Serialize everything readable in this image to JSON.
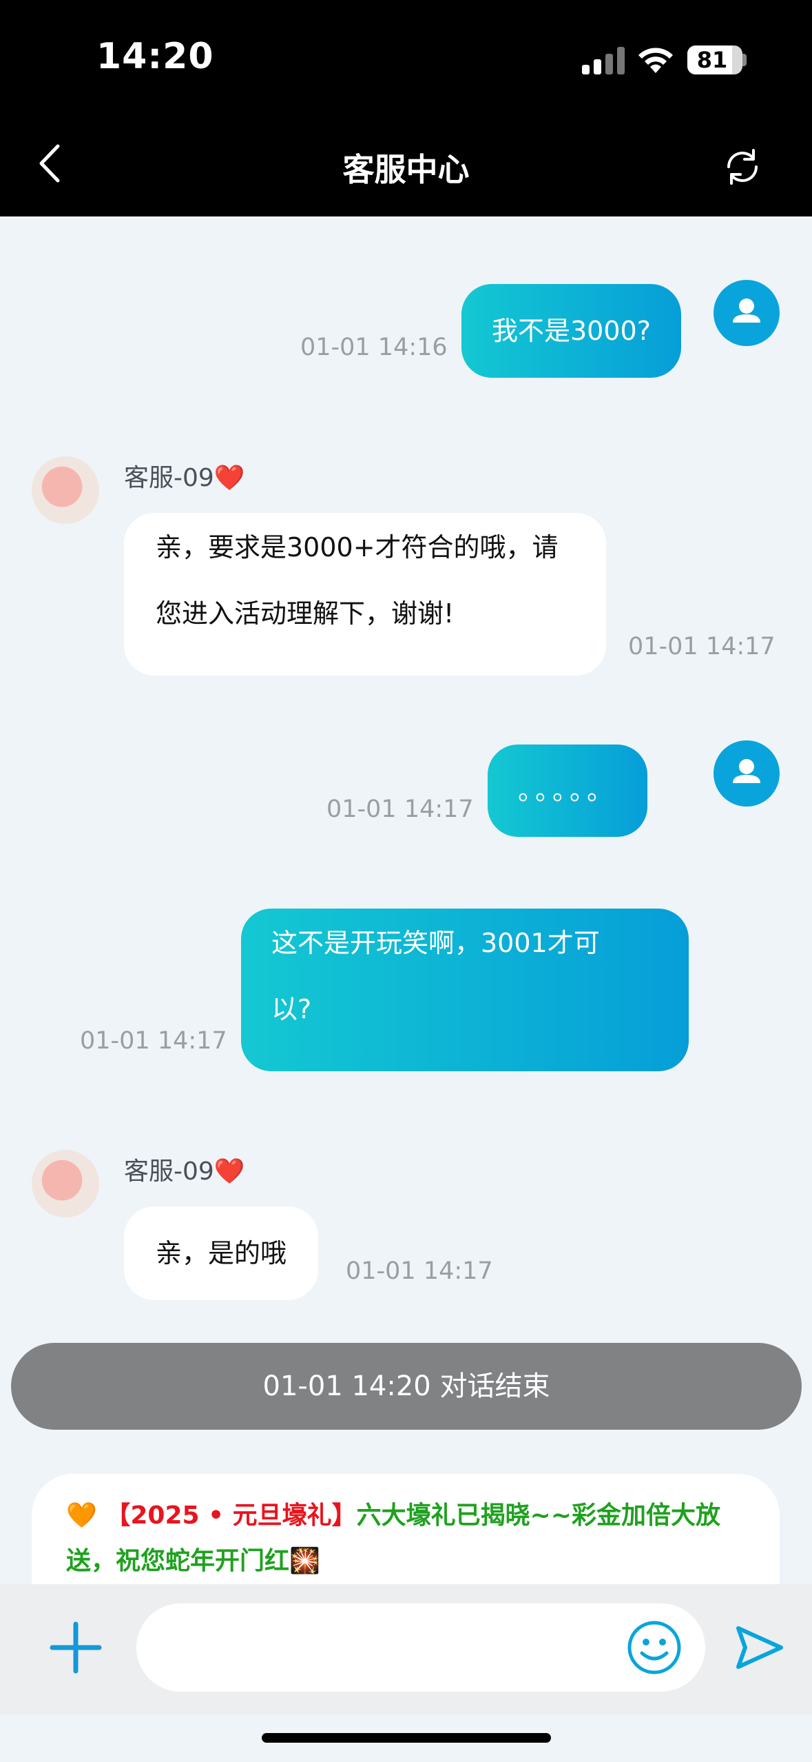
{
  "status_bar": {
    "time": "14:20",
    "battery": "81",
    "battery_level": 0.81
  },
  "nav": {
    "title": "客服中心"
  },
  "messages": [
    {
      "text": "我不是3000?",
      "time": "01-01 14:16"
    },
    {
      "agent": "客服-09",
      "heart": "❤️",
      "text_line1": "亲，要求是3000+才符合的哦，请",
      "text_line2": "您进入活动理解下，谢谢!",
      "time": "01-01 14:17"
    },
    {
      "text": "。。。。。",
      "time": "01-01 14:17"
    },
    {
      "text_line1": "这不是开玩笑啊，3001才可",
      "text_line2": "以?",
      "time": "01-01 14:17"
    },
    {
      "agent": "客服-09",
      "heart": "❤️",
      "text": "亲，是的哦",
      "time": "01-01 14:17"
    }
  ],
  "session_end": "01-01 14:20 对话结束",
  "promo": {
    "icon": "🧡",
    "red_text": "【2025 • 元旦壕礼】",
    "green_text": "六大壕礼已揭晓~~彩金加倍大放送，祝您蛇年开门红",
    "firework": "🎇"
  },
  "input": {
    "placeholder": ""
  }
}
